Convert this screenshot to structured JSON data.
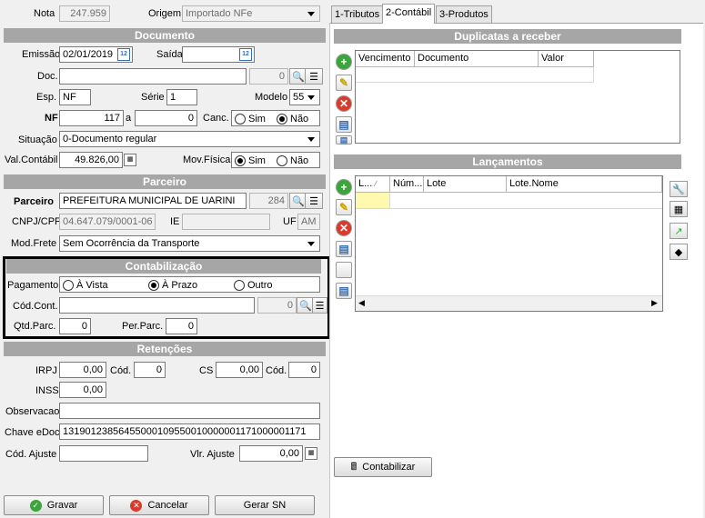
{
  "header": {
    "nota_label": "Nota",
    "nota_value": "247.959",
    "origem_label": "Origem",
    "origem_value": "Importado NFe"
  },
  "tabs": [
    "1-Tributos",
    "2-Contábil",
    "3-Produtos"
  ],
  "documento": {
    "title": "Documento",
    "emissao_label": "Emissão",
    "emissao_value": "02/01/2019",
    "saida_label": "Saída",
    "saida_value": "",
    "doc_label": "Doc.",
    "doc_value": "",
    "doc_num": "0",
    "esp_label": "Esp.",
    "esp_value": "NF",
    "serie_label": "Série",
    "serie_value": "1",
    "modelo_label": "Modelo",
    "modelo_value": "55",
    "nf_label": "NF",
    "nf_value": "117",
    "a_label": "a",
    "nf_to_value": "0",
    "canc_label": "Canc.",
    "canc_sim": "Sim",
    "canc_nao": "Não",
    "situacao_label": "Situação",
    "situacao_value": "0-Documento regular",
    "valcontabil_label": "Val.Contábil",
    "valcontabil_value": "49.826,00",
    "movfisica_label": "Mov.Física",
    "mov_sim": "Sim",
    "mov_nao": "Não"
  },
  "parceiro": {
    "title": "Parceiro",
    "parceiro_label": "Parceiro",
    "parceiro_value": "PREFEITURA MUNICIPAL DE UARINI",
    "parceiro_code": "284",
    "cnpj_label": "CNPJ/CPF",
    "cnpj_value": "04.647.079/0001-06",
    "ie_label": "IE",
    "ie_value": "",
    "uf_label": "UF",
    "uf_value": "AM",
    "modfrete_label": "Mod.Frete",
    "modfrete_value": "Sem Ocorrência da Transporte"
  },
  "contabilizacao": {
    "title": "Contabilização",
    "pagamento_label": "Pagamento",
    "opt_vista": "À Vista",
    "opt_prazo": "À Prazo",
    "opt_outro": "Outro",
    "codcont_label": "Cód.Cont.",
    "codcont_value": "",
    "codcont_num": "0",
    "qtdparc_label": "Qtd.Parc.",
    "qtdparc_value": "0",
    "perparc_label": "Per.Parc.",
    "perparc_value": "0"
  },
  "retencoes": {
    "title": "Retenções",
    "irpj_label": "IRPJ",
    "irpj_value": "0,00",
    "cod1_label": "Cód.",
    "cod1_value": "0",
    "cs_label": "CS",
    "cs_value": "0,00",
    "cod2_label": "Cód.",
    "cod2_value": "0",
    "inss_label": "INSS",
    "inss_value": "0,00",
    "obs_label": "Observacao",
    "obs_value": "",
    "chave_label": "Chave eDoc",
    "chave_value": "13190123856455000109550010000001171000001171",
    "codajuste_label": "Cód. Ajuste",
    "codajuste_value": "",
    "vlrajuste_label": "Vlr. Ajuste",
    "vlrajuste_value": "0,00"
  },
  "duplicatas": {
    "title": "Duplicatas a receber",
    "columns": [
      "Vencimento",
      "Documento",
      "Valor"
    ]
  },
  "lancamentos": {
    "title": "Lançamentos",
    "columns": [
      "L...",
      "Núm...",
      "Lote",
      "Lote.Nome"
    ]
  },
  "buttons": {
    "gravar": "Gravar",
    "cancelar": "Cancelar",
    "gerar_sn": "Gerar SN",
    "contabilizar": "Contabilizar"
  }
}
